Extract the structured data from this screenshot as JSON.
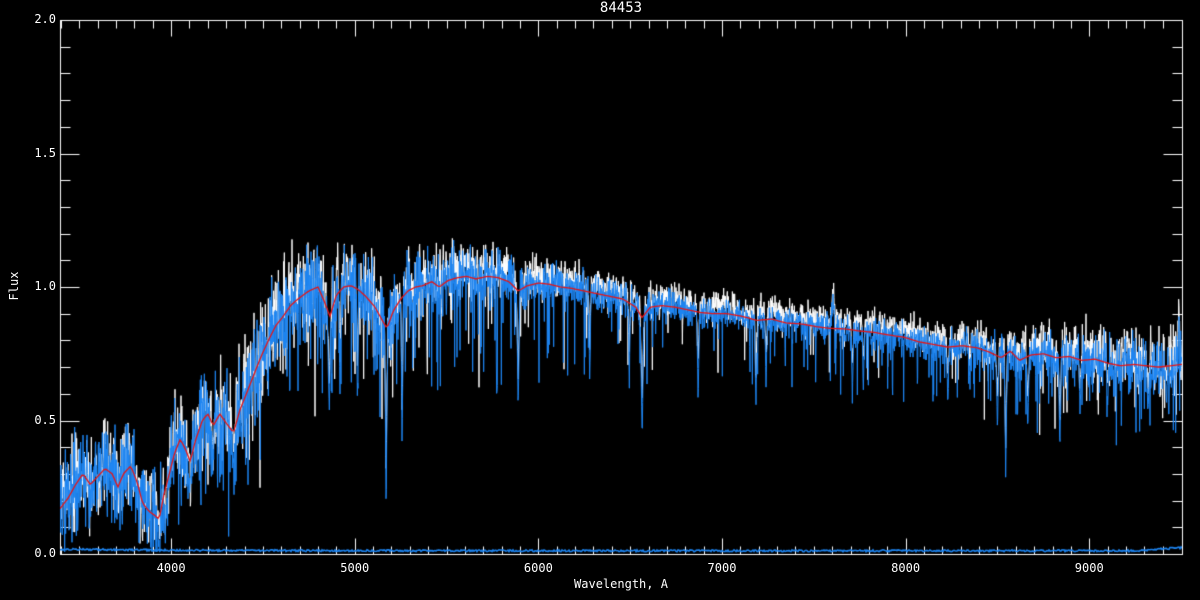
{
  "chart_data": {
    "type": "line",
    "title": "84453",
    "xlabel": "Wavelength, A",
    "ylabel": "Flux",
    "xlim": [
      3395,
      9505
    ],
    "ylim": [
      0.0,
      2.0
    ],
    "xticks": [
      4000,
      5000,
      6000,
      7000,
      8000,
      9000
    ],
    "yticks": [
      0.0,
      0.5,
      1.0,
      1.5,
      2.0
    ],
    "x_minor_step": 100,
    "y_minor_step": 0.1,
    "grid": false,
    "legend": "none",
    "background_color": "#000000",
    "axis_color": "#ffffff",
    "series": [
      {
        "name": "comparison-spectrum",
        "color": "#ffffff",
        "style": "noisy",
        "offset": 0.03,
        "seed": 77777,
        "forest_factor": 0.7,
        "line_shallow": 0.13
      },
      {
        "name": "observed-spectrum",
        "color": "#1d85f2",
        "style": "noisy",
        "offset": 0.0,
        "seed": 12345,
        "forest_factor": 1.0,
        "line_shallow": 0.0
      },
      {
        "name": "template-model",
        "color": "#e81414",
        "style": "smooth"
      },
      {
        "name": "error-spectrum",
        "color": "#1d85f2",
        "style": "flat"
      }
    ],
    "continuum_points": [
      [
        3395,
        0.17
      ],
      [
        3440,
        0.21
      ],
      [
        3480,
        0.26
      ],
      [
        3520,
        0.3
      ],
      [
        3560,
        0.26
      ],
      [
        3600,
        0.29
      ],
      [
        3640,
        0.32
      ],
      [
        3680,
        0.3
      ],
      [
        3710,
        0.25
      ],
      [
        3740,
        0.3
      ],
      [
        3780,
        0.33
      ],
      [
        3815,
        0.27
      ],
      [
        3845,
        0.19
      ],
      [
        3880,
        0.16
      ],
      [
        3910,
        0.145
      ],
      [
        3935,
        0.13
      ],
      [
        3960,
        0.22
      ],
      [
        3990,
        0.3
      ],
      [
        4020,
        0.38
      ],
      [
        4050,
        0.43
      ],
      [
        4080,
        0.39
      ],
      [
        4105,
        0.345
      ],
      [
        4130,
        0.42
      ],
      [
        4170,
        0.5
      ],
      [
        4200,
        0.525
      ],
      [
        4230,
        0.48
      ],
      [
        4265,
        0.525
      ],
      [
        4300,
        0.49
      ],
      [
        4340,
        0.455
      ],
      [
        4375,
        0.54
      ],
      [
        4410,
        0.6
      ],
      [
        4450,
        0.67
      ],
      [
        4490,
        0.74
      ],
      [
        4530,
        0.8
      ],
      [
        4570,
        0.855
      ],
      [
        4610,
        0.89
      ],
      [
        4650,
        0.93
      ],
      [
        4700,
        0.96
      ],
      [
        4750,
        0.985
      ],
      [
        4800,
        1.0
      ],
      [
        4835,
        0.945
      ],
      [
        4865,
        0.89
      ],
      [
        4900,
        0.97
      ],
      [
        4940,
        1.0
      ],
      [
        4980,
        1.005
      ],
      [
        5020,
        0.99
      ],
      [
        5060,
        0.965
      ],
      [
        5110,
        0.925
      ],
      [
        5150,
        0.875
      ],
      [
        5175,
        0.845
      ],
      [
        5210,
        0.91
      ],
      [
        5250,
        0.955
      ],
      [
        5290,
        0.985
      ],
      [
        5330,
        1.0
      ],
      [
        5370,
        1.005
      ],
      [
        5420,
        1.02
      ],
      [
        5460,
        1.0
      ],
      [
        5510,
        1.025
      ],
      [
        5560,
        1.035
      ],
      [
        5610,
        1.04
      ],
      [
        5660,
        1.03
      ],
      [
        5720,
        1.04
      ],
      [
        5780,
        1.035
      ],
      [
        5840,
        1.02
      ],
      [
        5890,
        0.985
      ],
      [
        5940,
        1.005
      ],
      [
        6000,
        1.015
      ],
      [
        6060,
        1.01
      ],
      [
        6120,
        1.0
      ],
      [
        6180,
        0.995
      ],
      [
        6250,
        0.985
      ],
      [
        6320,
        0.975
      ],
      [
        6390,
        0.965
      ],
      [
        6460,
        0.955
      ],
      [
        6530,
        0.925
      ],
      [
        6565,
        0.885
      ],
      [
        6610,
        0.925
      ],
      [
        6670,
        0.93
      ],
      [
        6740,
        0.925
      ],
      [
        6810,
        0.915
      ],
      [
        6880,
        0.905
      ],
      [
        6950,
        0.9
      ],
      [
        7030,
        0.9
      ],
      [
        7110,
        0.89
      ],
      [
        7190,
        0.875
      ],
      [
        7270,
        0.88
      ],
      [
        7350,
        0.865
      ],
      [
        7430,
        0.862
      ],
      [
        7510,
        0.852
      ],
      [
        7590,
        0.845
      ],
      [
        7670,
        0.843
      ],
      [
        7750,
        0.835
      ],
      [
        7830,
        0.83
      ],
      [
        7910,
        0.82
      ],
      [
        7990,
        0.812
      ],
      [
        8070,
        0.795
      ],
      [
        8150,
        0.785
      ],
      [
        8230,
        0.775
      ],
      [
        8310,
        0.78
      ],
      [
        8390,
        0.772
      ],
      [
        8460,
        0.755
      ],
      [
        8520,
        0.735
      ],
      [
        8570,
        0.76
      ],
      [
        8620,
        0.725
      ],
      [
        8680,
        0.745
      ],
      [
        8750,
        0.75
      ],
      [
        8820,
        0.735
      ],
      [
        8890,
        0.74
      ],
      [
        8960,
        0.725
      ],
      [
        9030,
        0.73
      ],
      [
        9100,
        0.715
      ],
      [
        9170,
        0.705
      ],
      [
        9240,
        0.71
      ],
      [
        9310,
        0.705
      ],
      [
        9380,
        0.7
      ],
      [
        9440,
        0.705
      ],
      [
        9505,
        0.71
      ]
    ],
    "absorption_lines": [
      [
        3933,
        0.03,
        10
      ],
      [
        3968,
        0.06,
        9
      ],
      [
        4101,
        0.24,
        12
      ],
      [
        4227,
        0.3,
        9
      ],
      [
        4340,
        0.33,
        11
      ],
      [
        4383,
        0.44,
        8
      ],
      [
        4861,
        0.5,
        12
      ],
      [
        4920,
        0.55,
        7
      ],
      [
        5015,
        0.52,
        7
      ],
      [
        5171,
        0.1,
        9
      ],
      [
        5258,
        0.35,
        8
      ],
      [
        5890,
        0.5,
        10
      ],
      [
        6280,
        0.62,
        8
      ],
      [
        6495,
        0.6,
        7
      ],
      [
        6565,
        0.4,
        11
      ],
      [
        6870,
        0.56,
        9
      ],
      [
        7185,
        0.52,
        9
      ],
      [
        7240,
        0.6,
        8
      ],
      [
        7710,
        0.55,
        8
      ],
      [
        7770,
        0.58,
        7
      ],
      [
        8230,
        0.52,
        8
      ],
      [
        8350,
        0.6,
        7
      ],
      [
        8500,
        0.46,
        10
      ],
      [
        8545,
        0.25,
        9
      ],
      [
        8665,
        0.45,
        10
      ],
      [
        8840,
        0.35,
        9
      ],
      [
        8950,
        0.5,
        8
      ],
      [
        9100,
        0.55,
        8
      ],
      [
        9320,
        0.5,
        8
      ],
      [
        9420,
        0.55,
        8
      ]
    ],
    "emission_spikes": [
      [
        7605,
        0.975,
        7
      ],
      [
        9487,
        0.83,
        6
      ]
    ],
    "noise_profile": [
      [
        3395,
        0.1
      ],
      [
        4000,
        0.11
      ],
      [
        4400,
        0.12
      ],
      [
        4800,
        0.1
      ],
      [
        5300,
        0.085
      ],
      [
        5700,
        0.065
      ],
      [
        6100,
        0.045
      ],
      [
        6700,
        0.035
      ],
      [
        7500,
        0.033
      ],
      [
        8200,
        0.04
      ],
      [
        8800,
        0.058
      ],
      [
        9505,
        0.075
      ]
    ],
    "absorption_forest": [
      {
        "from": 3395,
        "to": 4500,
        "prob": 0.2,
        "depth": 0.5
      },
      {
        "from": 4500,
        "to": 5800,
        "prob": 0.13,
        "depth": 0.42
      },
      {
        "from": 5800,
        "to": 6900,
        "prob": 0.07,
        "depth": 0.3
      },
      {
        "from": 6900,
        "to": 8600,
        "prob": 0.09,
        "depth": 0.28
      },
      {
        "from": 8600,
        "to": 9505,
        "prob": 0.13,
        "depth": 0.36
      }
    ],
    "error_spectrum": {
      "base": 0.012,
      "noise": 0.0035,
      "left_extra": 0.006,
      "right_extra": 0.012,
      "right_start": 9250,
      "seed": 555
    }
  }
}
